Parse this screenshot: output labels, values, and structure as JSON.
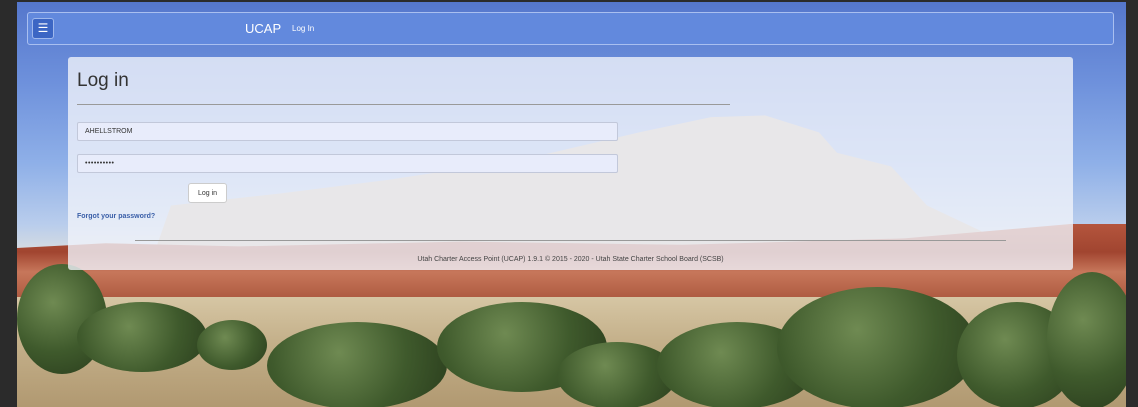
{
  "navbar": {
    "menu_icon": "hamburger-icon",
    "brand": "UCAP",
    "login_link": "Log In"
  },
  "login": {
    "title": "Log in",
    "username_value": "AHELLSTROM",
    "password_value": "••••••••••",
    "submit_label": "Log in",
    "forgot_label": "Forgot your password?"
  },
  "footer": {
    "text": "Utah Charter Access Point (UCAP) 1.9.1 © 2015 - 2020 - Utah State Charter School Board (SCSB)"
  },
  "colors": {
    "navbar": "#6289dd",
    "menu_button": "#3c66c4",
    "link": "#3a5fa8"
  }
}
